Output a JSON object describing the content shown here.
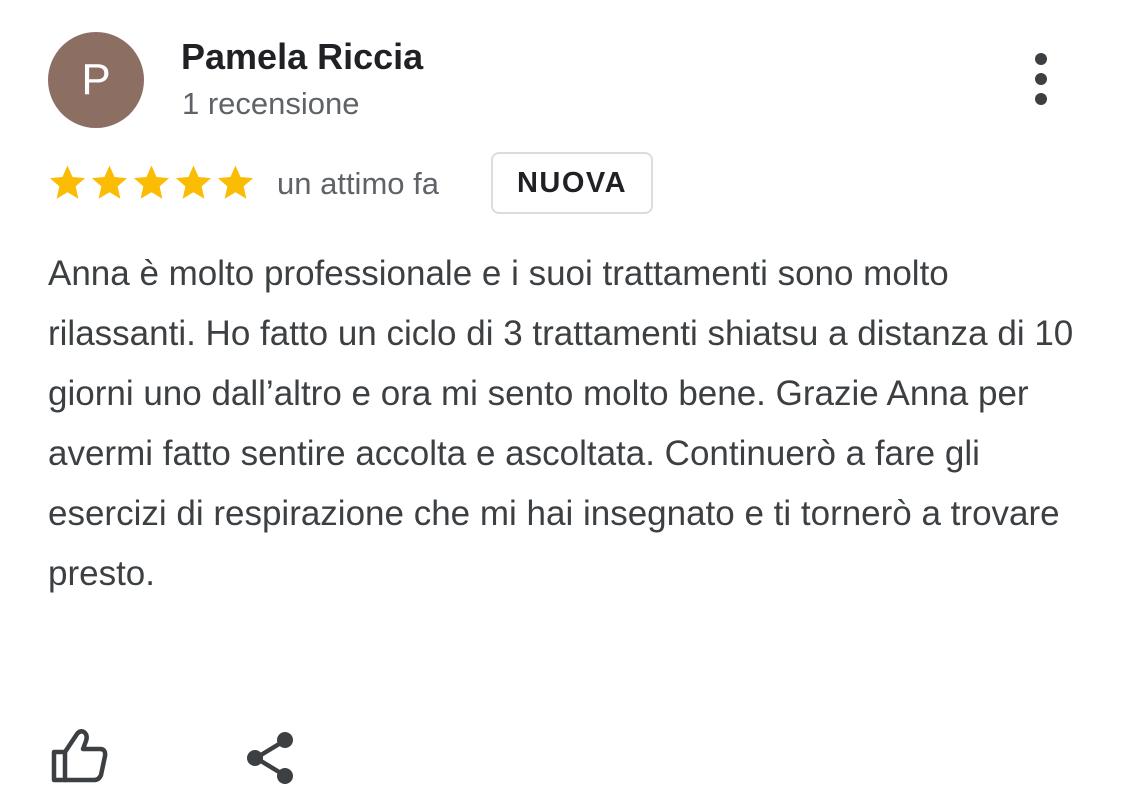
{
  "review": {
    "avatar_initial": "P",
    "avatar_color": "#8d6e63",
    "author_name": "Pamela Riccia",
    "review_count": "1 recensione",
    "rating": 5,
    "rating_max": 5,
    "star_color": "#fbbc04",
    "time_ago": "un attimo fa",
    "badge": "NUOVA",
    "text": "Anna è molto professionale e i suoi trattamenti sono molto rilassanti. Ho fatto un ciclo di 3 trattamenti shiatsu a distanza di 10 giorni uno dall’altro e ora mi sento molto bene. Grazie Anna per avermi fatto sentire accolta e ascoltata. Continuerò a fare gli esercizi di respirazione che mi hai insegnato e ti tornerò a trovare presto."
  },
  "menu": {
    "icon": "more-vertical-icon"
  },
  "actions": {
    "like_icon": "thumb-up-icon",
    "share_icon": "share-icon"
  }
}
